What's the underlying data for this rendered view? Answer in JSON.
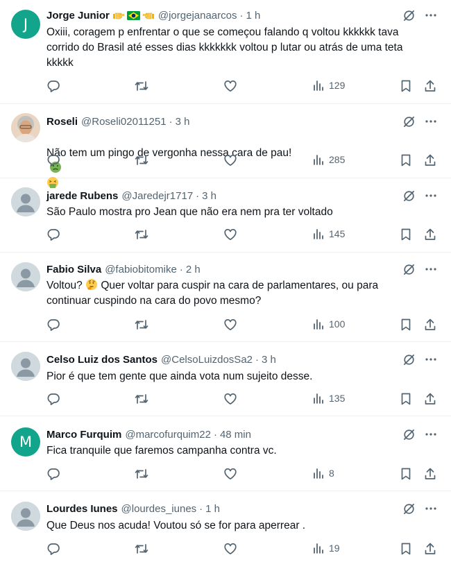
{
  "tweets": [
    {
      "name": "Jorge Junior",
      "name_emoji": [
        "pointing-right-emoji",
        "brazil-flag-emoji",
        "pointing-left-emoji"
      ],
      "handle": "@jorgejanaarcos",
      "time": "1 h",
      "avatar": {
        "type": "letter",
        "letter": "J",
        "color": "#13a58b"
      },
      "text": "Oxiii, coragem p enfrentar o que se começou falando q voltou kkkkkk tava\ncorrido do Brasil até esses dias kkkkkkk voltou p lutar ou atrás de uma teta\nkkkkk",
      "views": "129"
    },
    {
      "name": "Roseli",
      "handle": "@Roseli02011251",
      "time": "3 h",
      "avatar": {
        "type": "photo"
      },
      "text": "Não tem um pingo de vergonha nessa cara de pau!",
      "text_emoji": [
        "nauseated-face-emoji",
        "vomiting-face-emoji"
      ],
      "views": "285"
    },
    {
      "name": "jarede Rubens",
      "handle": "@Jaredejr1717",
      "time": "3 h",
      "avatar": {
        "type": "default"
      },
      "text": "São Paulo mostra pro Jean que não era nem pra ter voltado",
      "views": "145"
    },
    {
      "name": "Fabio Silva",
      "handle": "@fabiobitomike",
      "time": "2 h",
      "avatar": {
        "type": "default"
      },
      "text_before_emoji": "Voltou?",
      "text_emoji": [
        "thinking-face-emoji"
      ],
      "text_after_emoji": "Quer voltar para cuspir na cara de parlamentares, ou para\ncontinuar cuspindo na cara do povo mesmo?",
      "views": "100"
    },
    {
      "name": "Celso Luiz dos Santos",
      "handle": "@CelsoLuizdosSa2",
      "time": "3 h",
      "avatar": {
        "type": "default"
      },
      "text": "Pior é que tem gente que ainda vota num sujeito desse.",
      "views": "135"
    },
    {
      "name": "Marco Furquim",
      "handle": "@marcofurquim22",
      "time": "48 min",
      "avatar": {
        "type": "letter",
        "letter": "M",
        "color": "#13a58b"
      },
      "text": "Fica tranquile que faremos campanha contra vc.",
      "views": "8"
    },
    {
      "name": "Lourdes Iunes",
      "handle": "@lourdes_iunes",
      "time": "1 h",
      "avatar": {
        "type": "default"
      },
      "text": "Que Deus nos acuda!  Voutou só se for para aperrear .",
      "views": "19"
    }
  ],
  "icons": {
    "reply": "reply-icon",
    "retweet": "retweet-icon",
    "like": "like-icon",
    "views": "views-icon",
    "bookmark": "bookmark-icon",
    "share": "share-icon",
    "grok": "grok-icon",
    "more": "more-icon"
  },
  "colors": {
    "text": "#0f1419",
    "secondary": "#536471",
    "divider": "#eff3f4",
    "avatar_letter_bg": "#13a58b"
  }
}
